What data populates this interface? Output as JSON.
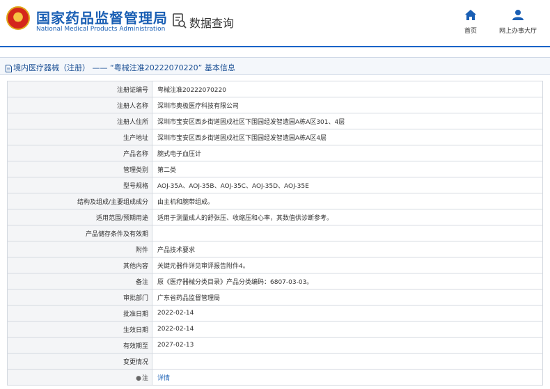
{
  "header": {
    "title_cn": "国家药品监督管理局",
    "title_en": "National Medical Products Administration",
    "query_label": "数据查询",
    "nav": [
      {
        "label": "首页",
        "icon": "home-icon"
      },
      {
        "label": "网上办事大厅",
        "icon": "user-icon"
      }
    ]
  },
  "breadcrumb": {
    "text": "境内医疗器械（注册） —— “粤械注准20222070220” 基本信息"
  },
  "colors": {
    "brand_blue": "#1a5fb4",
    "label_bg": "#f4f5f7",
    "border": "#d4d9e0"
  },
  "rows": [
    {
      "label": "注册证编号",
      "value": "粤械注准20222070220"
    },
    {
      "label": "注册人名称",
      "value": "深圳市奥极医疗科技有限公司"
    },
    {
      "label": "注册人住所",
      "value": "深圳市宝安区西乡街道固戍社区下围园经发智造园A栋A区301、4层"
    },
    {
      "label": "生产地址",
      "value": "深圳市宝安区西乡街道固戍社区下围园经发智造园A栋A区4层"
    },
    {
      "label": "产品名称",
      "value": "腕式电子血压计"
    },
    {
      "label": "管理类别",
      "value": "第二类"
    },
    {
      "label": "型号规格",
      "value": "AOJ-35A、AOJ-35B、AOJ-35C、AOJ-35D、AOJ-35E"
    },
    {
      "label": "结构及组成/主要组成成分",
      "value": "由主机和腕带组成。"
    },
    {
      "label": "适用范围/预期用途",
      "value": "适用于测量成人的舒张压、收缩压和心率，其数值供诊断参考。"
    },
    {
      "label": "产品储存条件及有效期",
      "value": ""
    },
    {
      "label": "附件",
      "value": "产品技术要求"
    },
    {
      "label": "其他内容",
      "value": "关键元器件详见审评报告附件4。"
    },
    {
      "label": "备注",
      "value": "原《医疗器械分类目录》产品分类编码：6807-03-03。"
    },
    {
      "label": "审批部门",
      "value": "广东省药品监督管理局"
    },
    {
      "label": "批准日期",
      "value": "2022-02-14"
    },
    {
      "label": "生效日期",
      "value": "2022-02-14"
    },
    {
      "label": "有效期至",
      "value": "2027-02-13"
    },
    {
      "label": "变更情况",
      "value": ""
    }
  ],
  "note_row": {
    "label": "注",
    "pin_icon": "pin-icon",
    "link": "详情"
  }
}
